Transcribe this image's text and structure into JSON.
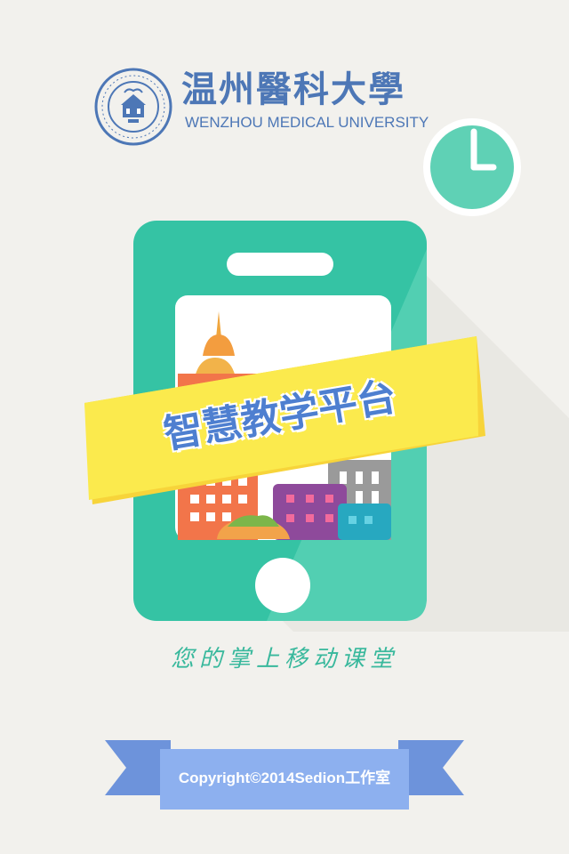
{
  "logo": {
    "name_cn": "温州醫科大學",
    "name_en": "WENZHOU MEDICAL UNIVERSITY",
    "seal_icon": "university-seal-icon"
  },
  "clock_icon": "clock-icon",
  "banner": {
    "title": "智慧教学平台"
  },
  "tagline": "您的掌上移动课堂",
  "footer": {
    "copyright": "Copyright©2014Sedion工作室"
  },
  "colors": {
    "background": "#f2f1ed",
    "brand_blue": "#4d77b6",
    "teal": "#3cc3a5",
    "teal_light": "#5bd0b4",
    "yellow": "#fbe84a",
    "ribbon_blue": "#6f96dd",
    "ribbon_light": "#8fb0ee"
  }
}
